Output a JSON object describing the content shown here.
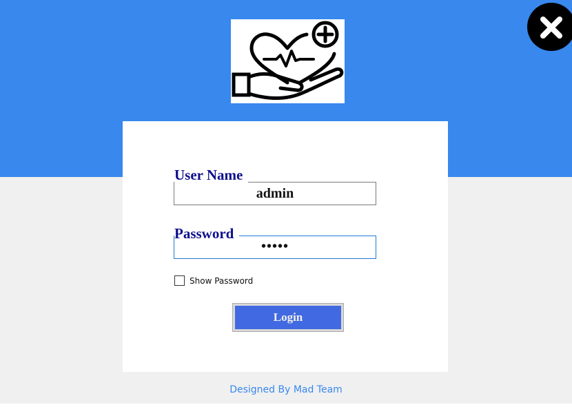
{
  "login_form": {
    "username_label": "User Name",
    "username_value": "admin",
    "password_label": "Password",
    "password_value": "•••••",
    "show_password_label": "Show Password",
    "show_password_checked": false,
    "login_label": "Login"
  },
  "footer": {
    "credit": "Designed By Mad Team"
  },
  "icons": {
    "close": "close-icon",
    "logo": "heart-hand-care-icon"
  },
  "colors": {
    "header_blue": "#3888ee",
    "label_navy": "#0f0f8c",
    "button_blue": "#4169e1",
    "focus_border": "#1e7bd0"
  }
}
